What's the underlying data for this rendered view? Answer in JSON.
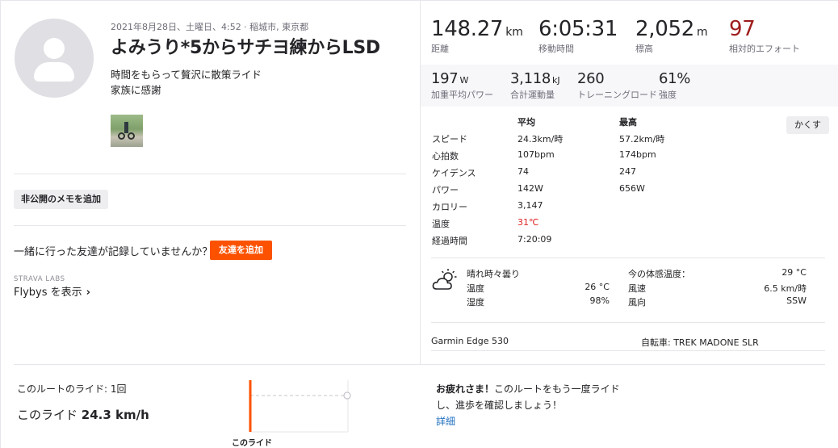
{
  "activity": {
    "meta": "2021年8月28日、土曜日、4:52 · 稲城市, 東京都",
    "title": "よみうり*5からサチヨ練からLSD",
    "desc_line1": "時間をもらって贅沢に散策ライド",
    "desc_line2": "家族に感謝"
  },
  "actions": {
    "private_note": "非公開のメモを追加",
    "friends_question": "一緒に行った友達が記録していませんか？",
    "add_friend": "友達を追加",
    "labs": "STRAVA LABS",
    "flybys": "Flybys を表示",
    "flybys_chevron": "›"
  },
  "stats": {
    "distance": {
      "value": "148.27",
      "unit": "km",
      "label": "距離"
    },
    "moving_time": {
      "value": "6:05:31",
      "label": "移動時間"
    },
    "elevation": {
      "value": "2,052",
      "unit": "m",
      "label": "標高"
    },
    "effort": {
      "value": "97",
      "label": "相対的エフォート"
    },
    "power": {
      "value": "197",
      "unit": "W",
      "label": "加重平均パワー"
    },
    "energy": {
      "value": "3,118",
      "unit": "kJ",
      "label": "合計運動量"
    },
    "training_load": {
      "value": "260",
      "label": "トレーニングロード"
    },
    "intensity": {
      "value": "61%",
      "label": "強度"
    }
  },
  "details": {
    "col_avg": "平均",
    "col_max": "最高",
    "hide": "かくす",
    "rows": [
      {
        "label": "スピード",
        "avg": "24.3km/時",
        "max": "57.2km/時"
      },
      {
        "label": "心拍数",
        "avg": "107bpm",
        "max": "174bpm"
      },
      {
        "label": "ケイデンス",
        "avg": "74",
        "max": "247"
      },
      {
        "label": "パワー",
        "avg": "142W",
        "max": "656W"
      },
      {
        "label": "カロリー",
        "avg": "3,147",
        "max": ""
      },
      {
        "label": "温度",
        "avg": "31℃",
        "max": ""
      },
      {
        "label": "経過時間",
        "avg": "7:20:09",
        "max": ""
      }
    ]
  },
  "weather": {
    "icon": "partly-cloudy-icon",
    "condition": "晴れ時々曇り",
    "temp_label": "温度",
    "temp_value": "26 °C",
    "humidity_label": "湿度",
    "humidity_value": "98%",
    "feels_label": "今の体感温度：",
    "feels_value": "29 °C",
    "wind_speed_label": "風速",
    "wind_speed_value": "6.5 km/時",
    "wind_dir_label": "風向",
    "wind_dir_value": "SSW"
  },
  "equipment": {
    "device": "Garmin Edge 530",
    "bike": "自転車: TREK MADONE SLR"
  },
  "route": {
    "count": "このルートのライド: 1回",
    "this_ride_label": "このライド",
    "this_ride_value": "24.3 km/h",
    "chart_label": "このライド",
    "congrats_bold": "お疲れさま！",
    "congrats_text": "このルートをもう一度ライドし、進歩を確認しましょう！",
    "detail_link": "詳細"
  },
  "colors": {
    "accent": "#fc5200",
    "effort": "#9e1c1c",
    "temp_red": "#e02424",
    "link": "#1f6fbf"
  }
}
